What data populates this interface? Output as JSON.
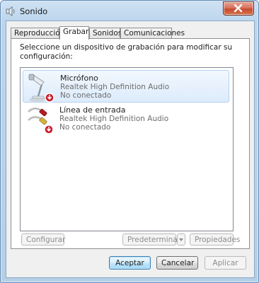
{
  "window": {
    "title": "Sonido",
    "title_icon": "speaker-icon",
    "close_icon": "close-icon"
  },
  "tabs": [
    {
      "label": "Reproducción",
      "active": false
    },
    {
      "label": "Grabar",
      "active": true
    },
    {
      "label": "Sonidos",
      "active": false
    },
    {
      "label": "Comunicaciones",
      "active": false
    }
  ],
  "instruction": "Seleccione un dispositivo de grabación para modificar su configuración:",
  "devices": [
    {
      "name": "Micrófono",
      "driver": "Realtek High Definition Audio",
      "status": "No conectado",
      "icon": "microphone-icon",
      "selected": true
    },
    {
      "name": "Línea de entrada",
      "driver": "Realtek High Definition Audio",
      "status": "No conectado",
      "icon": "line-in-icon",
      "selected": false
    }
  ],
  "buttons": {
    "configure": "Configurar",
    "set_default": "Predeterminar",
    "properties": "Propiedades",
    "ok": "Aceptar",
    "cancel": "Cancelar",
    "apply": "Aplicar"
  },
  "colors": {
    "accent": "#3c7fb1",
    "selection": "#dcebfc",
    "close": "#c44a30"
  }
}
